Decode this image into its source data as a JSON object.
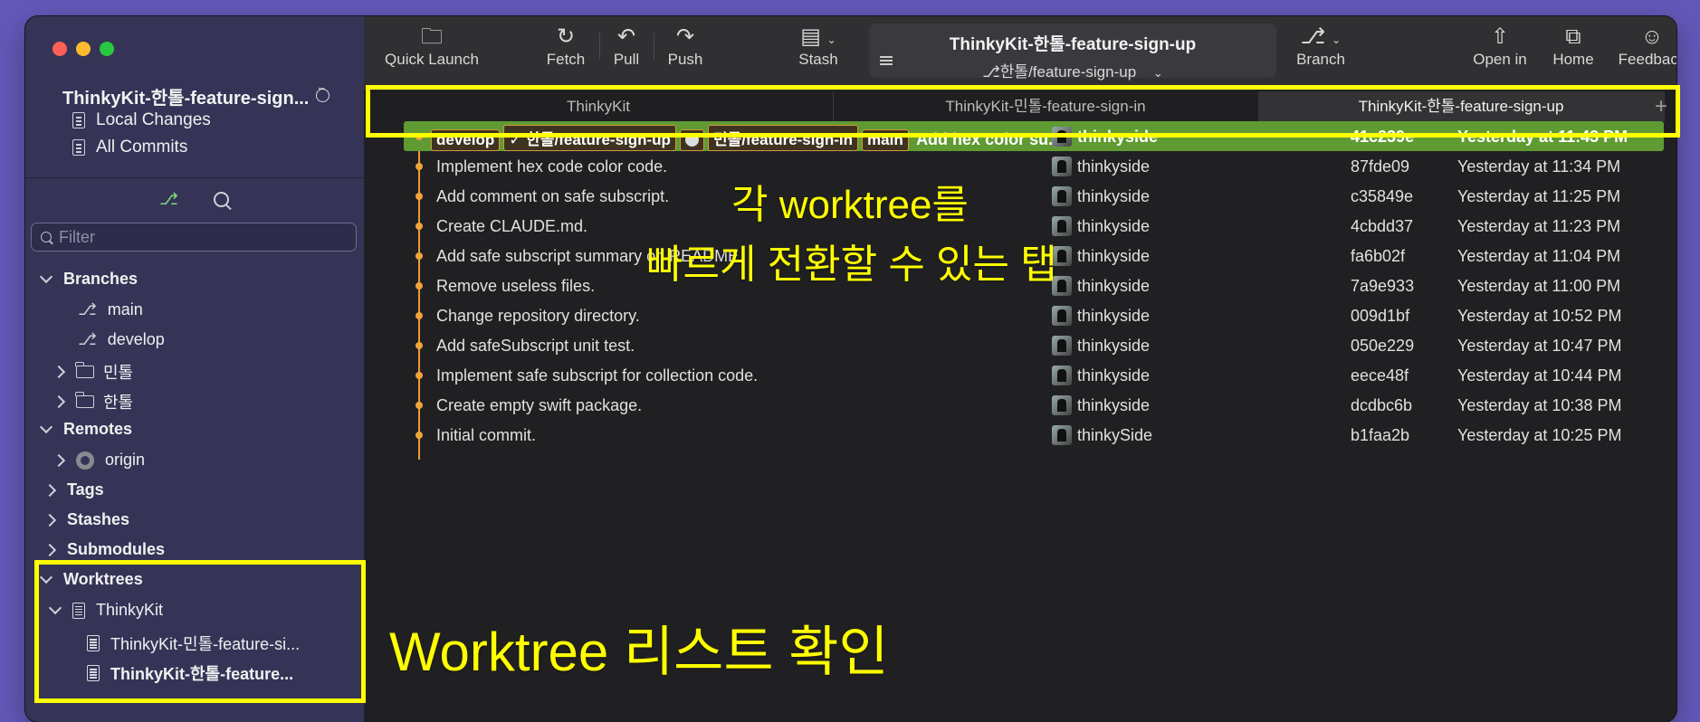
{
  "sidebar": {
    "repo_title": "ThinkyKit-한톨-feature-sign...",
    "nav": [
      {
        "label": "Local Changes",
        "icon": "local-changes-icon"
      },
      {
        "label": "All Commits",
        "icon": "all-commits-icon"
      }
    ],
    "filter_placeholder": "Filter",
    "sections": {
      "branches": "Branches",
      "remotes": "Remotes",
      "tags": "Tags",
      "stashes": "Stashes",
      "submodules": "Submodules",
      "worktrees": "Worktrees"
    },
    "branches": [
      "main",
      "develop"
    ],
    "branch_folders": [
      "민톨",
      "한톨"
    ],
    "remotes": [
      "origin"
    ],
    "worktree_root": "ThinkyKit",
    "worktrees": [
      "ThinkyKit-민톨-feature-si...",
      "ThinkyKit-한톨-feature..."
    ]
  },
  "toolbar": {
    "quick_launch": "Quick Launch",
    "fetch": "Fetch",
    "pull": "Pull",
    "push": "Push",
    "stash": "Stash",
    "repo_name": "ThinkyKit-한톨-feature-sign-up",
    "current_branch": "한톨/feature-sign-up",
    "branch": "Branch",
    "open_in": "Open in",
    "home": "Home",
    "feedback": "Feedback"
  },
  "tabs": [
    {
      "label": "ThinkyKit",
      "active": false
    },
    {
      "label": "ThinkyKit-민톨-feature-sign-in",
      "active": false
    },
    {
      "label": "ThinkyKit-한톨-feature-sign-up",
      "active": true
    }
  ],
  "selected_commit": {
    "refs": [
      "develop",
      "✓ 한톨/feature-sign-up",
      "민톨/feature-sign-in",
      "main"
    ],
    "message": "Add hex color su...",
    "author": "thinkyside",
    "sha": "41c239e",
    "date": "Yesterday at 11:43 PM"
  },
  "commits": [
    {
      "message": "Implement hex code color code.",
      "author": "thinkyside",
      "sha": "87fde09",
      "date": "Yesterday at 11:34 PM"
    },
    {
      "message": "Add comment on safe subscript.",
      "author": "thinkyside",
      "sha": "c35849e",
      "date": "Yesterday at 11:25 PM"
    },
    {
      "message": "Create CLAUDE.md.",
      "author": "thinkyside",
      "sha": "4cbdd37",
      "date": "Yesterday at 11:23 PM"
    },
    {
      "message": "Add safe subscript summary on README.",
      "author": "thinkyside",
      "sha": "fa6b02f",
      "date": "Yesterday at 11:04 PM"
    },
    {
      "message": "Remove useless files.",
      "author": "thinkyside",
      "sha": "7a9e933",
      "date": "Yesterday at 11:00 PM"
    },
    {
      "message": "Change repository directory.",
      "author": "thinkyside",
      "sha": "009d1bf",
      "date": "Yesterday at 10:52 PM"
    },
    {
      "message": "Add safeSubscript unit test.",
      "author": "thinkyside",
      "sha": "050e229",
      "date": "Yesterday at 10:47 PM"
    },
    {
      "message": "Implement safe subscript for collection code.",
      "author": "thinkyside",
      "sha": "eece48f",
      "date": "Yesterday at 10:44 PM"
    },
    {
      "message": "Create empty swift package.",
      "author": "thinkyside",
      "sha": "dcdbc6b",
      "date": "Yesterday at 10:38 PM"
    },
    {
      "message": "Initial commit.",
      "author": "thinkySide",
      "sha": "b1faa2b",
      "date": "Yesterday at 10:25 PM"
    }
  ],
  "annotations": {
    "tabs_line1": "각 worktree를",
    "tabs_line2": "빠르게 전환할 수 있는 탭",
    "worktree_list": "Worktree 리스트 확인"
  },
  "colors": {
    "highlight": "#ffff00",
    "selected_row": "#609a33",
    "graph": "#e99b34",
    "background": "#6358b8"
  }
}
